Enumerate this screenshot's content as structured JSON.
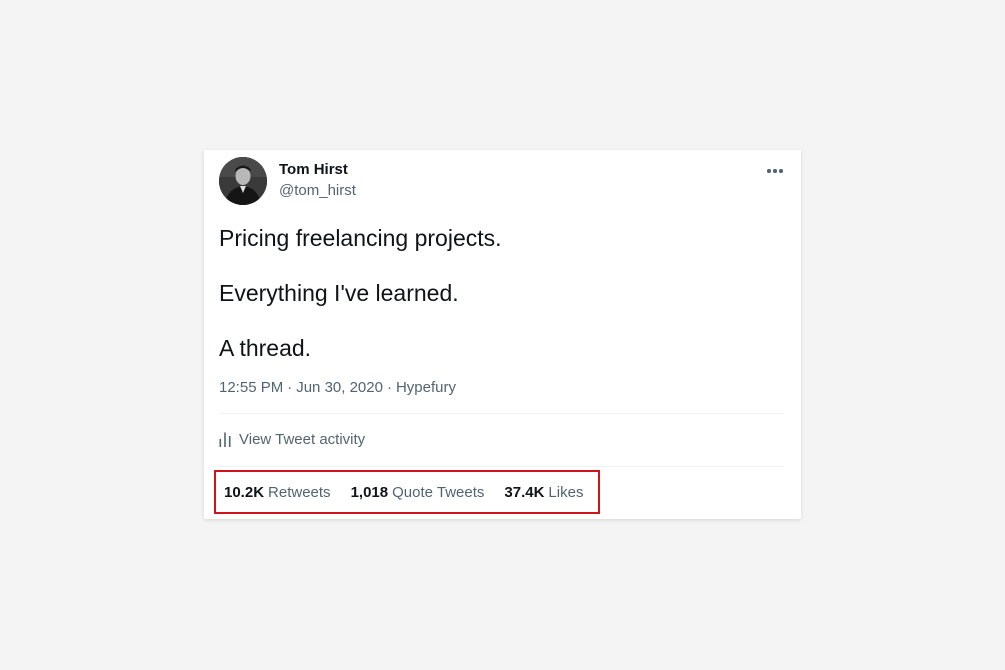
{
  "author": {
    "name": "Tom Hirst",
    "handle": "@tom_hirst",
    "avatar_icon": "avatar-photo"
  },
  "more_icon": "more-horizontal-icon",
  "tweet": {
    "lines": [
      "Pricing freelancing projects.",
      "Everything I've learned.",
      "A thread."
    ]
  },
  "meta": {
    "time": "12:55 PM",
    "date": "Jun 30, 2020",
    "separator": "·",
    "source": "Hypefury"
  },
  "activity": {
    "icon": "bar-chart-icon",
    "label": "View Tweet activity"
  },
  "stats": [
    {
      "value": "10.2K",
      "label": "Retweets"
    },
    {
      "value": "1,018",
      "label": "Quote Tweets"
    },
    {
      "value": "37.4K",
      "label": "Likes"
    }
  ],
  "colors": {
    "highlight_border": "#d0141c",
    "text_primary": "#0f1419",
    "text_secondary": "#536471"
  }
}
